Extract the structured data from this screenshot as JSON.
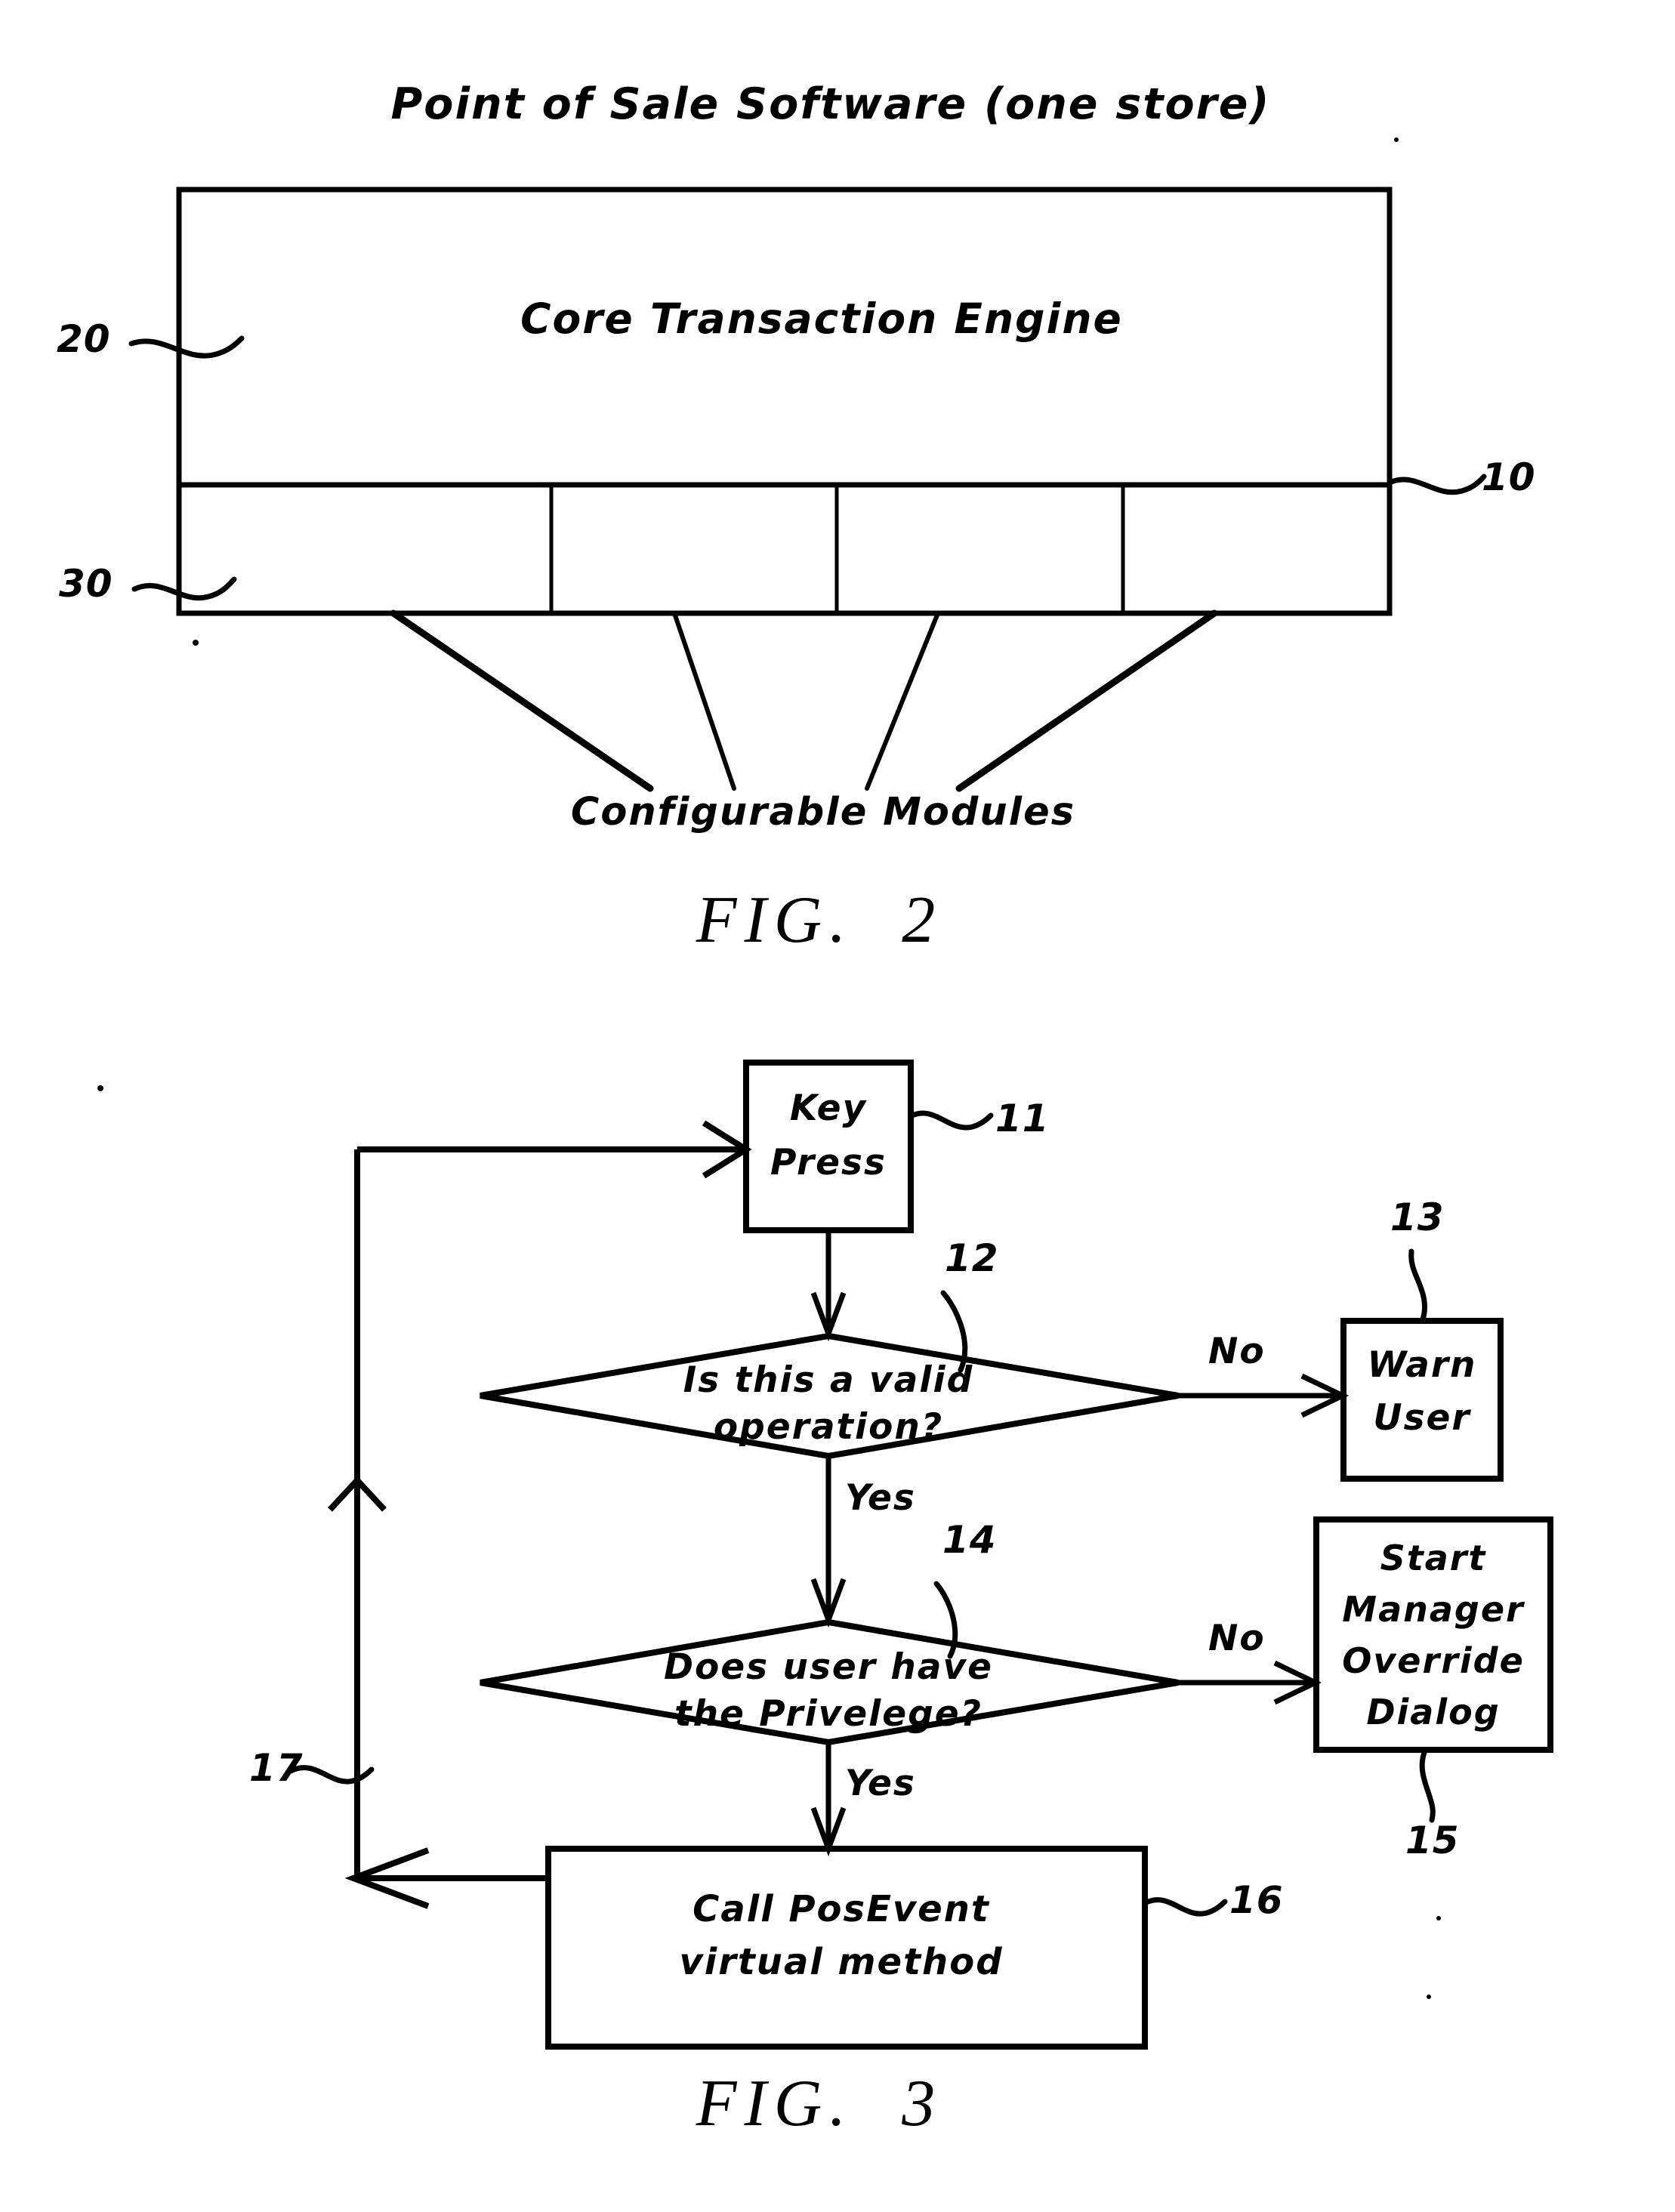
{
  "document": {
    "type": "patent-drawing-sheet",
    "figures": [
      "FIG. 2",
      "FIG. 3"
    ]
  },
  "fig2": {
    "caption": "FIG.  2",
    "title": "Point of Sale Software (one store)",
    "core_block": {
      "label": "Core Transaction Engine",
      "ref": "20"
    },
    "system_ref": "10",
    "modules_row": {
      "ref": "30",
      "caption": "Configurable Modules",
      "cells": [
        "",
        "",
        "",
        ""
      ]
    }
  },
  "fig3": {
    "caption": "FIG.  3",
    "nodes": [
      {
        "id": "key_press",
        "shape": "process",
        "label_line1": "Key",
        "label_line2": "Press",
        "ref": "11"
      },
      {
        "id": "valid_op",
        "shape": "decision",
        "label_line1": "Is this a valid",
        "label_line2": "operation?",
        "ref": "12"
      },
      {
        "id": "warn_user",
        "shape": "process",
        "label_line1": "Warn",
        "label_line2": "User",
        "ref": "13"
      },
      {
        "id": "privilege",
        "shape": "decision",
        "label_line1": "Does user have",
        "label_line2": "the Privelege?",
        "ref": "14"
      },
      {
        "id": "manager_override",
        "shape": "process",
        "label_line1": "Start",
        "label_line2": "Manager",
        "label_line3": "Override",
        "label_line4": "Dialog",
        "ref": "15"
      },
      {
        "id": "call_posevent",
        "shape": "process",
        "label_line1": "Call PosEvent",
        "label_line2": "virtual method",
        "ref": "16"
      }
    ],
    "edges": [
      {
        "from": "valid_op",
        "to": "warn_user",
        "label": "No"
      },
      {
        "from": "valid_op",
        "to": "privilege",
        "label": "Yes"
      },
      {
        "from": "privilege",
        "to": "manager_override",
        "label": "No"
      },
      {
        "from": "privilege",
        "to": "call_posevent",
        "label": "Yes"
      },
      {
        "from": "call_posevent",
        "to": "key_press",
        "label": "",
        "ref": "17"
      }
    ],
    "loop_ref": "17"
  },
  "colors": {
    "ink": "#000000",
    "paper": "#ffffff"
  }
}
